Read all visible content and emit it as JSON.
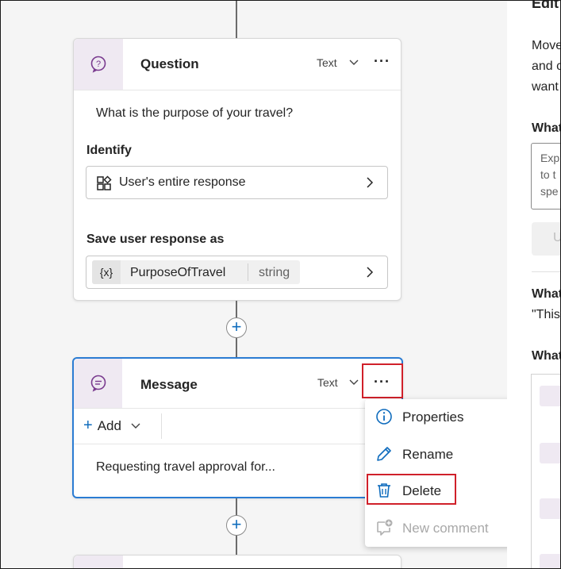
{
  "question_card": {
    "title": "Question",
    "type_label": "Text",
    "prompt": "What is the purpose of your travel?",
    "identify_label": "Identify",
    "identify_value": "User's entire response",
    "save_label": "Save user response as",
    "variable_symbol": "{x}",
    "variable_name": "PurposeOfTravel",
    "variable_type": "string"
  },
  "message_card": {
    "title": "Message",
    "type_label": "Text",
    "add_label": "Add",
    "message_text": "Requesting travel approval for..."
  },
  "context_menu": {
    "items": [
      {
        "label": "Properties",
        "icon": "info-icon",
        "enabled": true
      },
      {
        "label": "Rename",
        "icon": "pencil-icon",
        "enabled": true
      },
      {
        "label": "Delete",
        "icon": "trash-icon",
        "enabled": true
      },
      {
        "label": "New comment",
        "icon": "comment-add-icon",
        "enabled": false
      }
    ]
  },
  "right_panel": {
    "heading_partial": "Edit",
    "desc_lines": [
      "Move",
      "and c",
      "want"
    ],
    "section1": "What",
    "input_placeholder_lines": [
      "Exp",
      "to t",
      "spe"
    ],
    "button_partial": "U",
    "section2": "What",
    "quote_partial": "\"This",
    "section3": "What"
  },
  "colors": {
    "accent": "#0f6cbd",
    "highlight": "#d0202a",
    "icon_purple": "#7a3b8f",
    "node_icon_bg": "#efe9f2"
  }
}
